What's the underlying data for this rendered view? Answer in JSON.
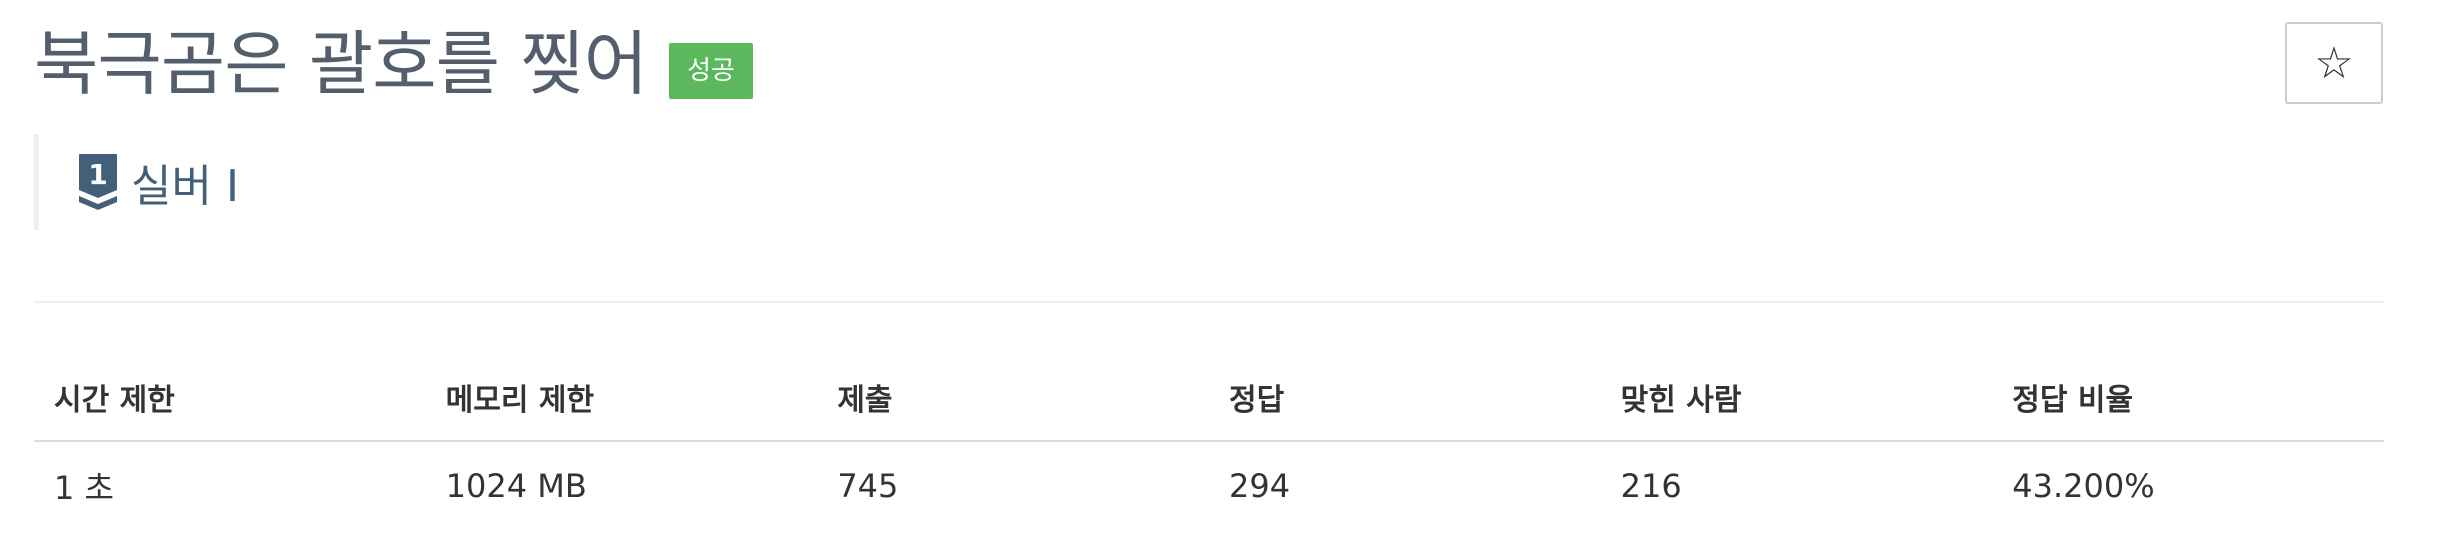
{
  "problem": {
    "title": "북극곰은 괄호를 찢어",
    "status_badge": "성공",
    "tier": {
      "number": "1",
      "label": "실버 I",
      "color": "#435f7a"
    }
  },
  "star_button": {
    "icon": "star-outline-icon",
    "glyph": "☆"
  },
  "info_table": {
    "headers": [
      "시간 제한",
      "메모리 제한",
      "제출",
      "정답",
      "맞힌 사람",
      "정답 비율"
    ],
    "values": [
      "1 초",
      "1024 MB",
      "745",
      "294",
      "216",
      "43.200%"
    ]
  },
  "colors": {
    "badge_success": "#5cb85c",
    "title": "#555e6d"
  }
}
